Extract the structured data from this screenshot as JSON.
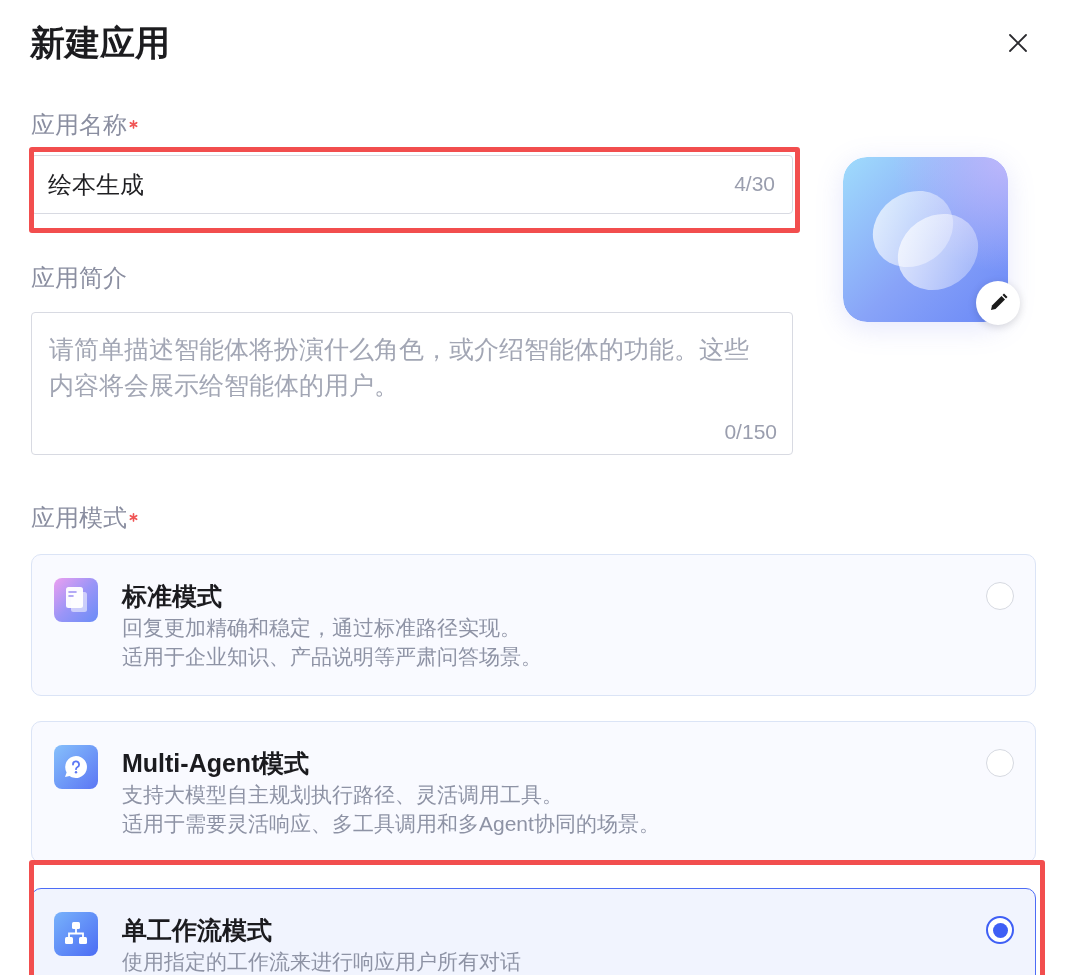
{
  "dialog": {
    "title": "新建应用"
  },
  "name_field": {
    "label": "应用名称",
    "required": true,
    "value": "绘本生成",
    "counter": "4/30",
    "highlighted": true
  },
  "intro_field": {
    "label": "应用简介",
    "required": false,
    "placeholder": "请简单描述智能体将扮演什么角色，或介绍智能体的功能。这些内容将会展示给智能体的用户。",
    "counter": "0/150"
  },
  "mode_field": {
    "label": "应用模式",
    "required": true,
    "options": [
      {
        "kind": "standard",
        "title": "标准模式",
        "description": [
          "回复更加精确和稳定，通过标准路径实现。",
          "适用于企业知识、产品说明等严肃问答场景。"
        ],
        "selected": false,
        "highlighted": false
      },
      {
        "kind": "multi_agent",
        "title": "Multi-Agent模式",
        "description": [
          "支持大模型自主规划执行路径、灵活调用工具。",
          "适用于需要灵活响应、多工具调用和多Agent协同的场景。"
        ],
        "selected": false,
        "highlighted": false
      },
      {
        "kind": "workflow",
        "title": "单工作流模式",
        "description": [
          "使用指定的工作流来进行响应用户所有对话"
        ],
        "selected": true,
        "highlighted": true
      }
    ]
  }
}
